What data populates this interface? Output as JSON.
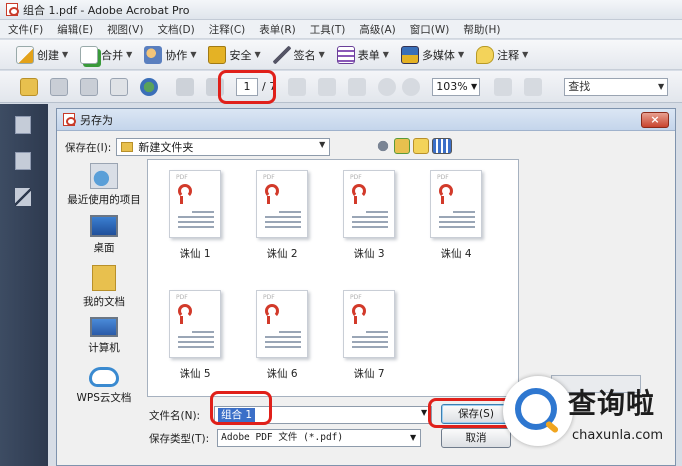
{
  "window": {
    "title": "组合 1.pdf - Adobe Acrobat Pro"
  },
  "menu": [
    "文件(F)",
    "编辑(E)",
    "视图(V)",
    "文档(D)",
    "注释(C)",
    "表单(R)",
    "工具(T)",
    "高级(A)",
    "窗口(W)",
    "帮助(H)"
  ],
  "toolbar1": {
    "create": "创建",
    "combine": "合并",
    "collaborate": "协作",
    "secure": "安全",
    "sign": "签名",
    "forms": "表单",
    "multimedia": "多媒体",
    "comment": "注释"
  },
  "toolbar2": {
    "page_current": "1",
    "page_total": "/ 7",
    "zoom": "103%",
    "find_placeholder": "查找"
  },
  "dialog": {
    "title": "另存为",
    "close_label": "×",
    "save_in_label": "保存在(I):",
    "save_in_value": "新建文件夹",
    "places": [
      "最近使用的项目",
      "桌面",
      "我的文档",
      "计算机",
      "WPS云文档"
    ],
    "files": [
      "诛仙 1",
      "诛仙 2",
      "诛仙 3",
      "诛仙 4",
      "诛仙 5",
      "诛仙 6",
      "诛仙 7"
    ],
    "file_tag": "PDF",
    "filename_label": "文件名(N):",
    "filename_value": "组合 1",
    "filetype_label": "保存类型(T):",
    "filetype_value": "Adobe PDF 文件 (*.pdf)",
    "save_button": "保存(S)",
    "cancel_button": "取消"
  },
  "watermark": {
    "brand": "查询啦",
    "url": "chaxunla.com"
  },
  "colors": {
    "highlight": "#e0201a",
    "selection": "#3b6fc8",
    "nav_panel": "#3d4c63"
  }
}
